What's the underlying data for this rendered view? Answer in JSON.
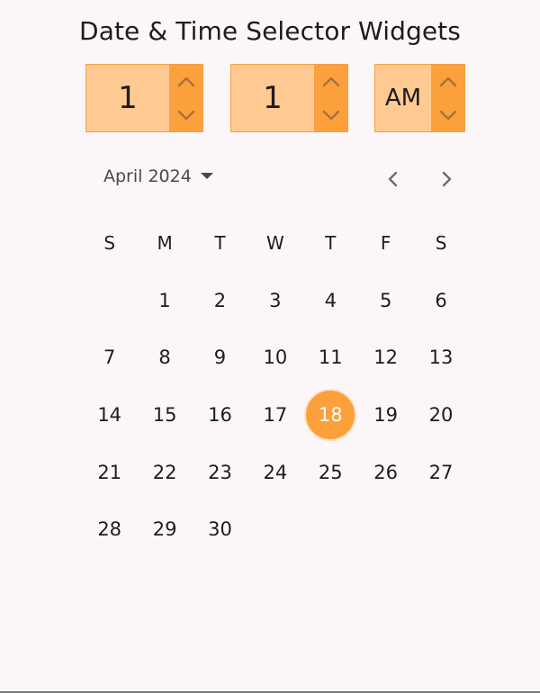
{
  "title": "Date & Time Selector Widgets",
  "time_picker": {
    "hour": "1",
    "minute": "1",
    "period": "AM"
  },
  "calendar": {
    "month_label": "April 2024",
    "weekdays": [
      "S",
      "M",
      "T",
      "W",
      "T",
      "F",
      "S"
    ],
    "leading_blanks": 1,
    "days": [
      "1",
      "2",
      "3",
      "4",
      "5",
      "6",
      "7",
      "8",
      "9",
      "10",
      "11",
      "12",
      "13",
      "14",
      "15",
      "16",
      "17",
      "18",
      "19",
      "20",
      "21",
      "22",
      "23",
      "24",
      "25",
      "26",
      "27",
      "28",
      "29",
      "30"
    ],
    "selected_day": "18"
  },
  "colors": {
    "accent": "#fba03b",
    "spinner_field": "#ffca91",
    "background": "#fdf6f9"
  },
  "icons": {
    "up": "chevron-up-icon",
    "down": "chevron-down-icon",
    "dropdown": "caret-down-icon",
    "prev": "chevron-left-icon",
    "next": "chevron-right-icon"
  }
}
